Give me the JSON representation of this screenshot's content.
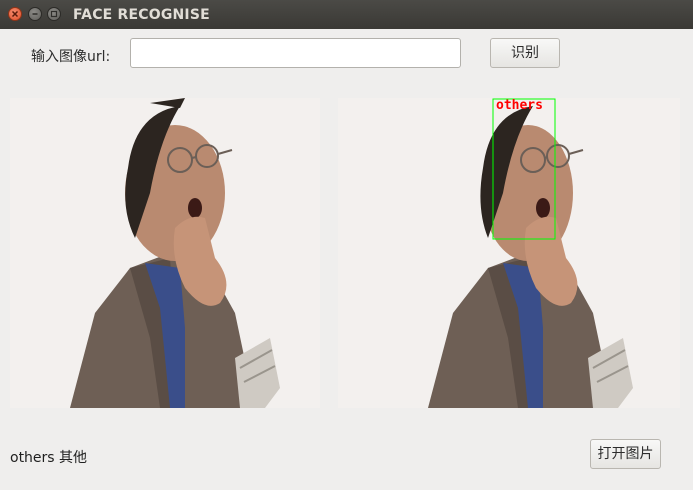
{
  "window": {
    "title": "FACE RECOGNISE"
  },
  "url_row": {
    "label": "输入图像url:",
    "input_value": "",
    "input_placeholder": "",
    "recognize_button": "识别"
  },
  "images": {
    "detection_label": "others",
    "box_color": "#00ff00",
    "label_color": "#ff0000"
  },
  "result": {
    "text": "others 其他"
  },
  "open_button": "打开图片"
}
